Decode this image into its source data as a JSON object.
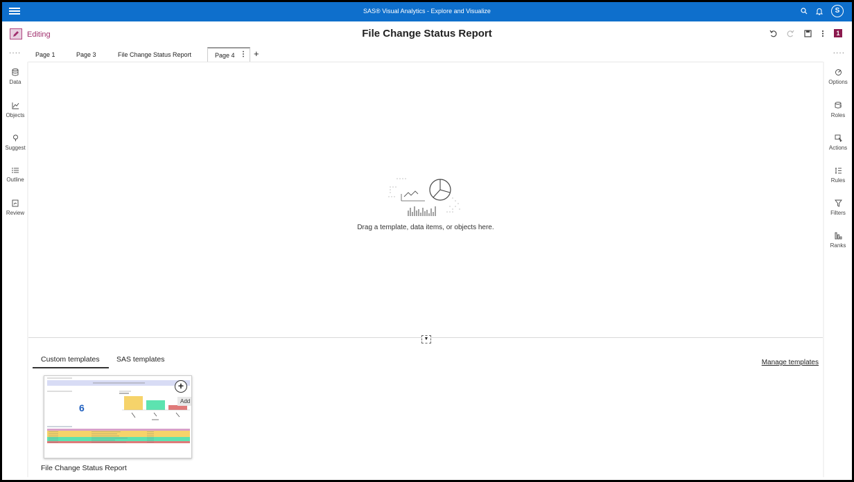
{
  "app": {
    "title": "SAS® Visual Analytics - Explore and Visualize",
    "avatar_letter": "S"
  },
  "header": {
    "mode_label": "Editing",
    "report_title": "File Change Status Report",
    "page_badge": "1"
  },
  "tabs": [
    {
      "label": "Page 1"
    },
    {
      "label": "Page 3"
    },
    {
      "label": "File Change Status Report"
    },
    {
      "label": "Page 4"
    }
  ],
  "left_rail": [
    {
      "label": "Data",
      "icon": "database-icon"
    },
    {
      "label": "Objects",
      "icon": "chart-line-icon"
    },
    {
      "label": "Suggest",
      "icon": "lightbulb-icon"
    },
    {
      "label": "Outline",
      "icon": "list-icon"
    },
    {
      "label": "Review",
      "icon": "review-icon"
    }
  ],
  "right_rail": [
    {
      "label": "Options",
      "icon": "options-icon"
    },
    {
      "label": "Roles",
      "icon": "roles-icon"
    },
    {
      "label": "Actions",
      "icon": "actions-icon"
    },
    {
      "label": "Rules",
      "icon": "rules-icon"
    },
    {
      "label": "Filters",
      "icon": "filter-icon"
    },
    {
      "label": "Ranks",
      "icon": "ranks-icon"
    }
  ],
  "canvas": {
    "drop_message": "Drag a template, data items, or objects here."
  },
  "templates": {
    "tabs": [
      {
        "label": "Custom templates"
      },
      {
        "label": "SAS templates"
      }
    ],
    "manage_label": "Manage templates",
    "items": [
      {
        "name": "File Change Status Report",
        "count": "6",
        "add_label": "Add"
      }
    ]
  },
  "colors": {
    "topbar": "#0e6fcc",
    "editing": "#a0306e",
    "page_badge": "#8b1a4e"
  }
}
